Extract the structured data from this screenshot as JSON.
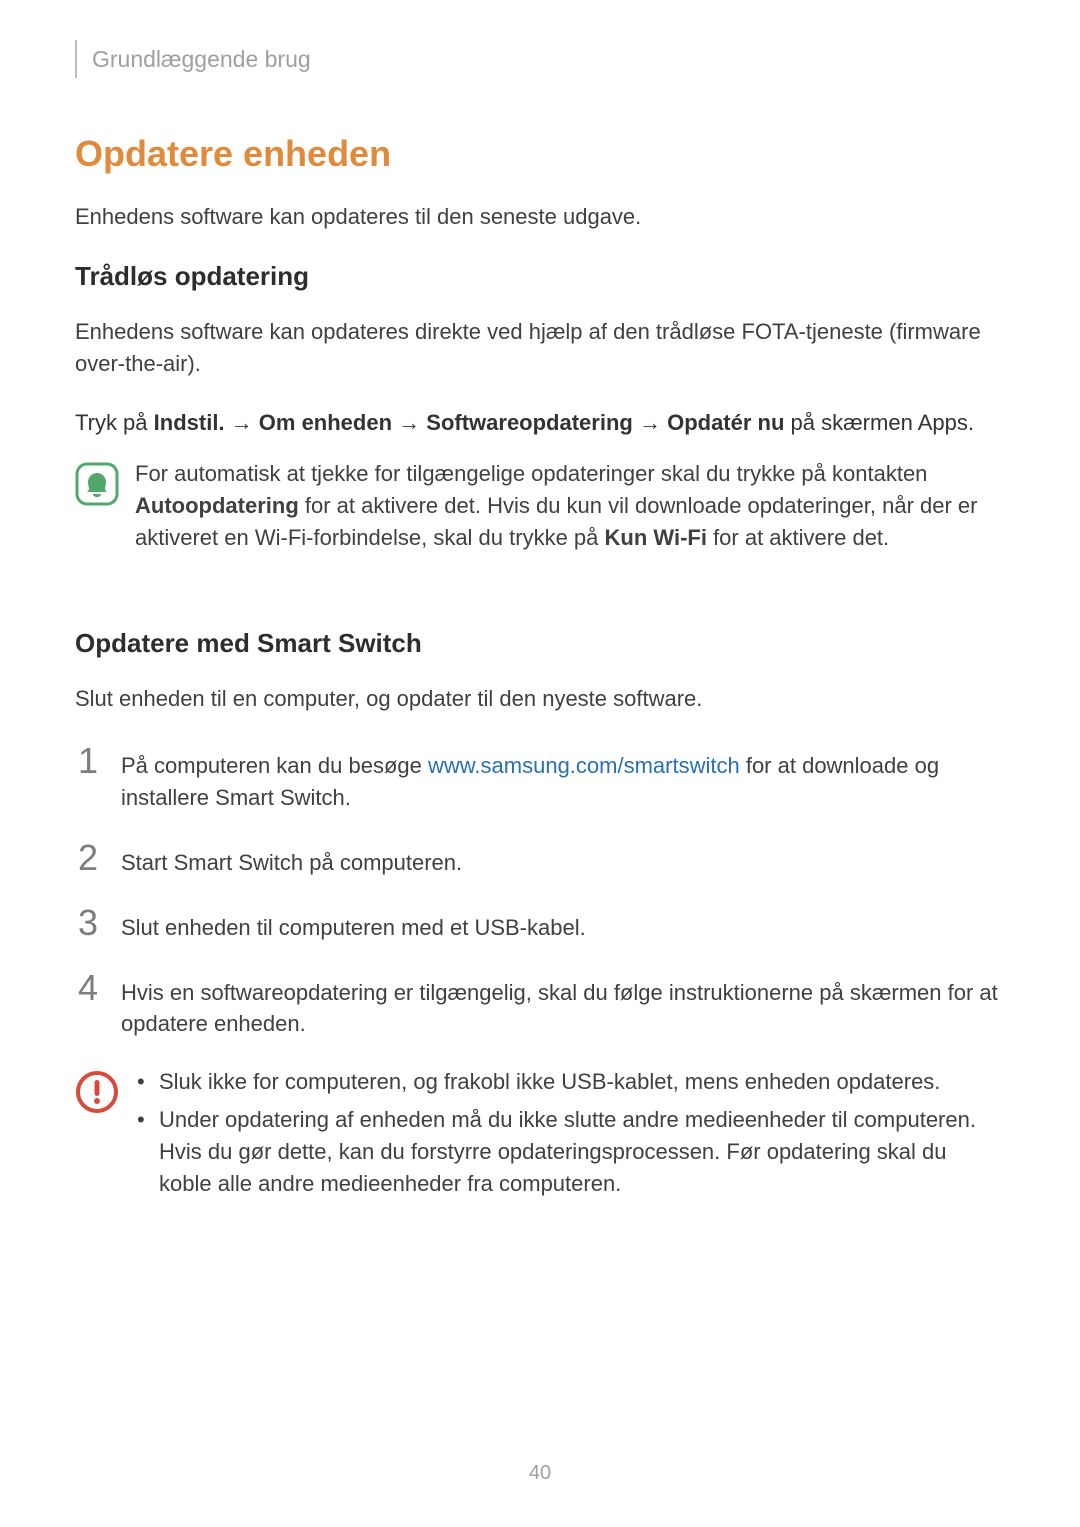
{
  "header": {
    "breadcrumb": "Grundlæggende brug"
  },
  "title": "Opdatere enheden",
  "intro": "Enhedens software kan opdateres til den seneste udgave.",
  "wireless": {
    "heading": "Trådløs opdatering",
    "desc": "Enhedens software kan opdateres direkte ved hjælp af den trådløse FOTA-tjeneste (firmware over-the-air).",
    "path_prefix": "Tryk på ",
    "path_b1": "Indstil.",
    "path_arrow": " → ",
    "path_b2": "Om enheden",
    "path_b3": "Softwareopdatering",
    "path_b4": "Opdatér nu",
    "path_suffix": " på skærmen Apps.",
    "note_pre": "For automatisk at tjekke for tilgængelige opdateringer skal du trykke på kontakten ",
    "note_b1": "Autoopdatering",
    "note_mid": " for at aktivere det. Hvis du kun vil downloade opdateringer, når der er aktiveret en Wi-Fi-forbindelse, skal du trykke på ",
    "note_b2": "Kun Wi-Fi",
    "note_post": " for at aktivere det."
  },
  "smartswitch": {
    "heading": "Opdatere med Smart Switch",
    "desc": "Slut enheden til en computer, og opdater til den nyeste software.",
    "step1_pre": "På computeren kan du besøge ",
    "step1_link": "www.samsung.com/smartswitch",
    "step1_post": " for at downloade og installere Smart Switch.",
    "step2": "Start Smart Switch på computeren.",
    "step3": "Slut enheden til computeren med et USB-kabel.",
    "step4": "Hvis en softwareopdatering er tilgængelig, skal du følge instruktionerne på skærmen for at opdatere enheden.",
    "warn1": "Sluk ikke for computeren, og frakobl ikke USB-kablet, mens enheden opdateres.",
    "warn2": "Under opdatering af enheden må du ikke slutte andre medieenheder til computeren. Hvis du gør dette, kan du forstyrre opdateringsprocessen. Før opdatering skal du koble alle andre medieenheder fra computeren."
  },
  "nums": {
    "n1": "1",
    "n2": "2",
    "n3": "3",
    "n4": "4"
  },
  "page_number": "40"
}
